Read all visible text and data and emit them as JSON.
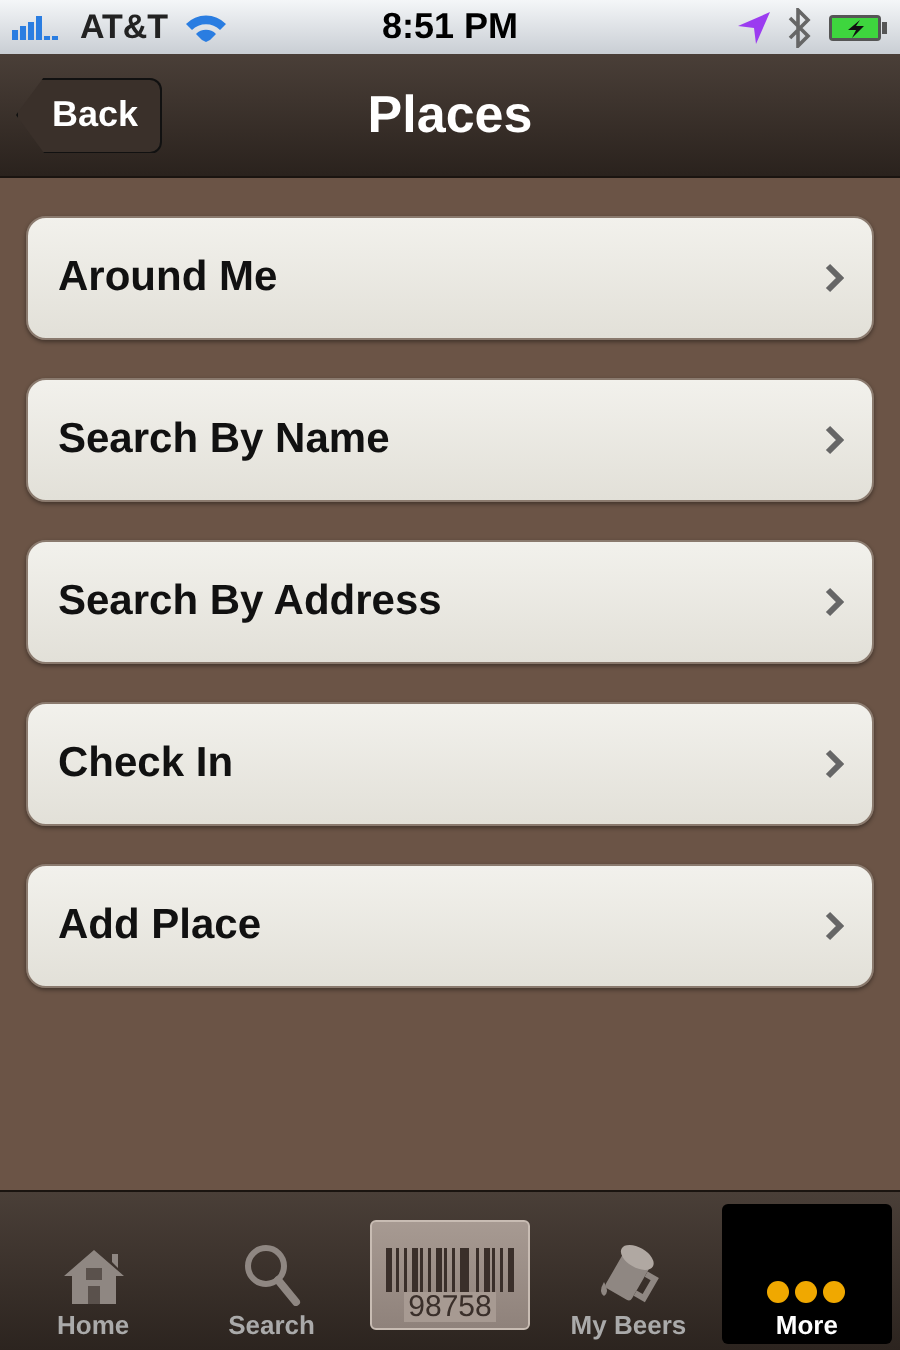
{
  "status_bar": {
    "carrier": "AT&T",
    "time": "8:51 PM"
  },
  "nav_bar": {
    "back": "Back",
    "title": "Places"
  },
  "menu": [
    {
      "label": "Around Me"
    },
    {
      "label": "Search By Name"
    },
    {
      "label": "Search By Address"
    },
    {
      "label": "Check In"
    },
    {
      "label": "Add Place"
    }
  ],
  "tab_bar": [
    {
      "kind": "home",
      "label": "Home",
      "selected": false
    },
    {
      "kind": "search",
      "label": "Search",
      "selected": false
    },
    {
      "kind": "barcode",
      "label": "98758",
      "selected": false
    },
    {
      "kind": "beers",
      "label": "My Beers",
      "selected": false
    },
    {
      "kind": "more",
      "label": "More",
      "selected": true
    }
  ]
}
